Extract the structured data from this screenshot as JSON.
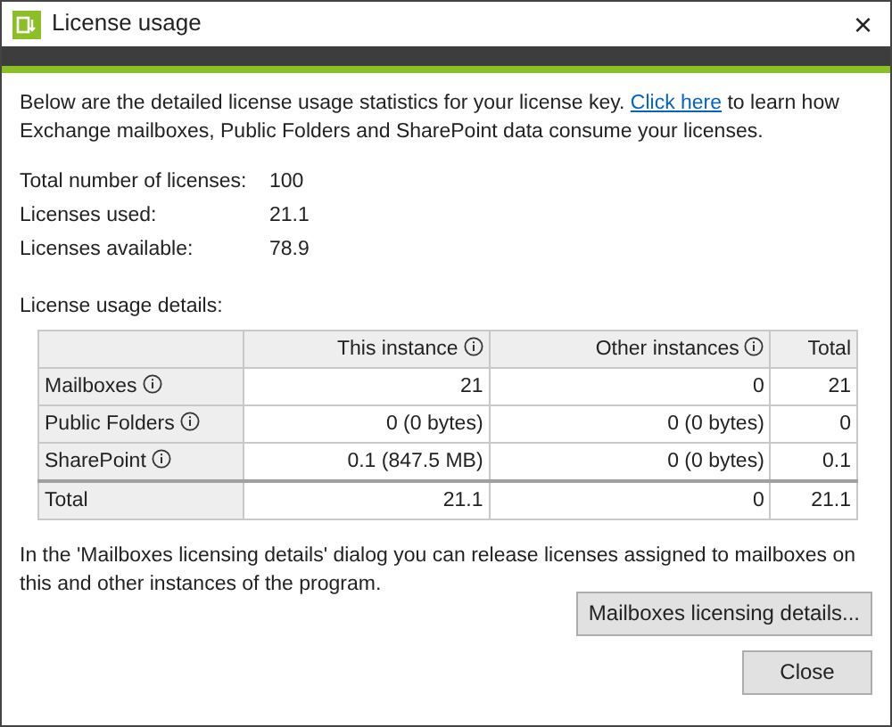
{
  "window": {
    "title": "License usage",
    "close": "×"
  },
  "intro": {
    "before": "Below are the detailed license usage statistics for your license key. ",
    "link": "Click here",
    "after": " to learn how Exchange mailboxes, Public Folders and SharePoint data consume your licenses."
  },
  "summary": [
    {
      "label": "Total number of licenses:",
      "value": "100"
    },
    {
      "label": "Licenses used:",
      "value": "21.1"
    },
    {
      "label": "Licenses available:",
      "value": "78.9"
    }
  ],
  "details_label": "License usage details:",
  "table": {
    "columns": [
      {
        "label": "This instance",
        "info": true
      },
      {
        "label": "Other instances",
        "info": true
      },
      {
        "label": "Total",
        "info": false
      }
    ],
    "rows": [
      {
        "label": "Mailboxes",
        "info": true,
        "cells": [
          "21",
          "0",
          "21"
        ]
      },
      {
        "label": "Public Folders",
        "info": true,
        "cells": [
          "0 (0 bytes)",
          "0 (0 bytes)",
          "0"
        ]
      },
      {
        "label": "SharePoint",
        "info": true,
        "cells": [
          "0.1 (847.5 MB)",
          "0 (0 bytes)",
          "0.1"
        ]
      },
      {
        "label": "Total",
        "info": false,
        "cells": [
          "21.1",
          "0",
          "21.1"
        ]
      }
    ]
  },
  "footer_note": "In the 'Mailboxes licensing details' dialog you can release licenses assigned to mailboxes on this and other instances of the program.",
  "buttons": {
    "details": "Mailboxes licensing details...",
    "close": "Close"
  }
}
